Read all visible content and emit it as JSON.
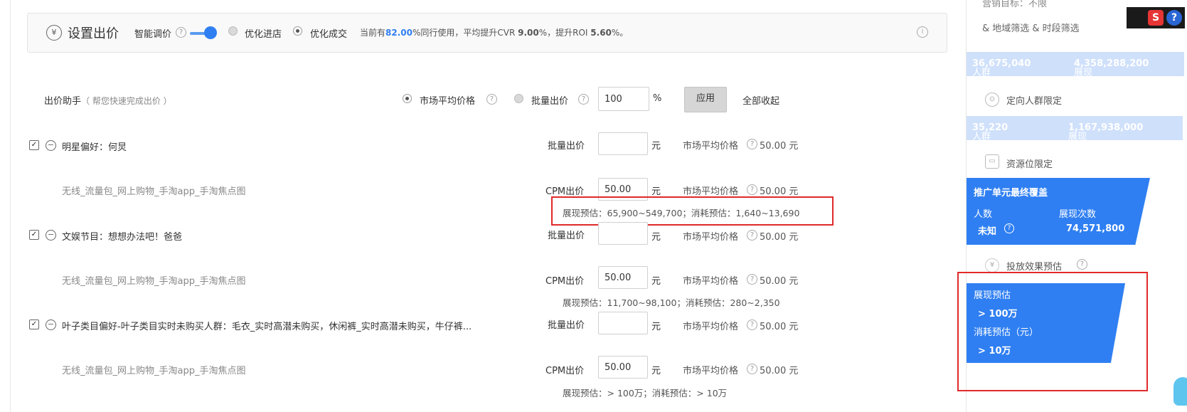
{
  "header": {
    "title": "设置出价",
    "smart_price_label": "智能调价",
    "opt_visit_label": "优化进店",
    "opt_deal_label": "优化成交",
    "stat_prefix": "当前有",
    "stat_pct": "82.00",
    "stat_mid": "%同行使用，平均提升CVR ",
    "cvr": "9.00",
    "stat_mid2": "%，提升ROI ",
    "roi": "5.60",
    "stat_suffix": "%。"
  },
  "assistant": {
    "label": "出价助手",
    "hint": "（ 帮您快速完成出价 ）",
    "market_avg_label": "市场平均价格",
    "batch_label": "批量出价",
    "batch_value": "100",
    "pct": "%",
    "apply_label": "应用",
    "collapse_all_label": "全部收起"
  },
  "groups": [
    {
      "name": "明星偏好：何炅",
      "batch_label": "批量出价",
      "unit": "元",
      "market_label": "市场平均价格",
      "market_value": "50.00 元",
      "sub_name": "无线_流量包_网上购物_手淘app_手淘焦点图",
      "cpm_label": "CPM出价",
      "cpm_value": "50.00",
      "estimate": "展现预估：65,900~549,700；消耗预估：1,640~13,690"
    },
    {
      "name": "文娱节目：想想办法吧！爸爸",
      "batch_label": "批量出价",
      "unit": "元",
      "market_label": "市场平均价格",
      "market_value": "50.00 元",
      "sub_name": "无线_流量包_网上购物_手淘app_手淘焦点图",
      "cpm_label": "CPM出价",
      "cpm_value": "50.00",
      "estimate": "展现预估：11,700~98,100；消耗预估：280~2,350"
    },
    {
      "name": "叶子类目偏好-叶子类目实时未购买人群：毛衣_实时高潜未购买，休闲裤_实时高潜未购买，牛仔裤...",
      "batch_label": "批量出价",
      "unit": "元",
      "market_label": "市场平均价格",
      "market_value": "50.00 元",
      "sub_name": "无线_流量包_网上购物_手淘app_手淘焦点图",
      "cpm_label": "CPM出价",
      "cpm_value": "50.00",
      "estimate": "展现预估：> 100万；消耗预估：> 10万"
    }
  ],
  "sidebar": {
    "marketing_goal": "营销目标：不限",
    "filters": "& 地域筛选 & 时段筛选",
    "band1": {
      "crowd_label": "人群",
      "crowd_value": "36,675,040",
      "show_label": "展现",
      "show_value": "4,358,288,200"
    },
    "targeting_label": "定向人群限定",
    "band2": {
      "crowd_label": "人群",
      "crowd_value": "35,220",
      "show_label": "展现",
      "show_value": "1,167,938,000"
    },
    "resource_label": "资源位限定",
    "coverage": {
      "title": "推广单元最终覆盖",
      "people_label": "人数",
      "people_value": "未知",
      "shows_label": "展现次数",
      "shows_value": "74,571,800"
    },
    "effect_label": "投放效果预估",
    "effect": {
      "show_est_label": "展现预估",
      "show_est_value": "> 100万",
      "cost_est_label": "消耗预估（元）",
      "cost_est_value": "> 10万"
    }
  },
  "tray": {
    "s": "S",
    "q": "?"
  }
}
